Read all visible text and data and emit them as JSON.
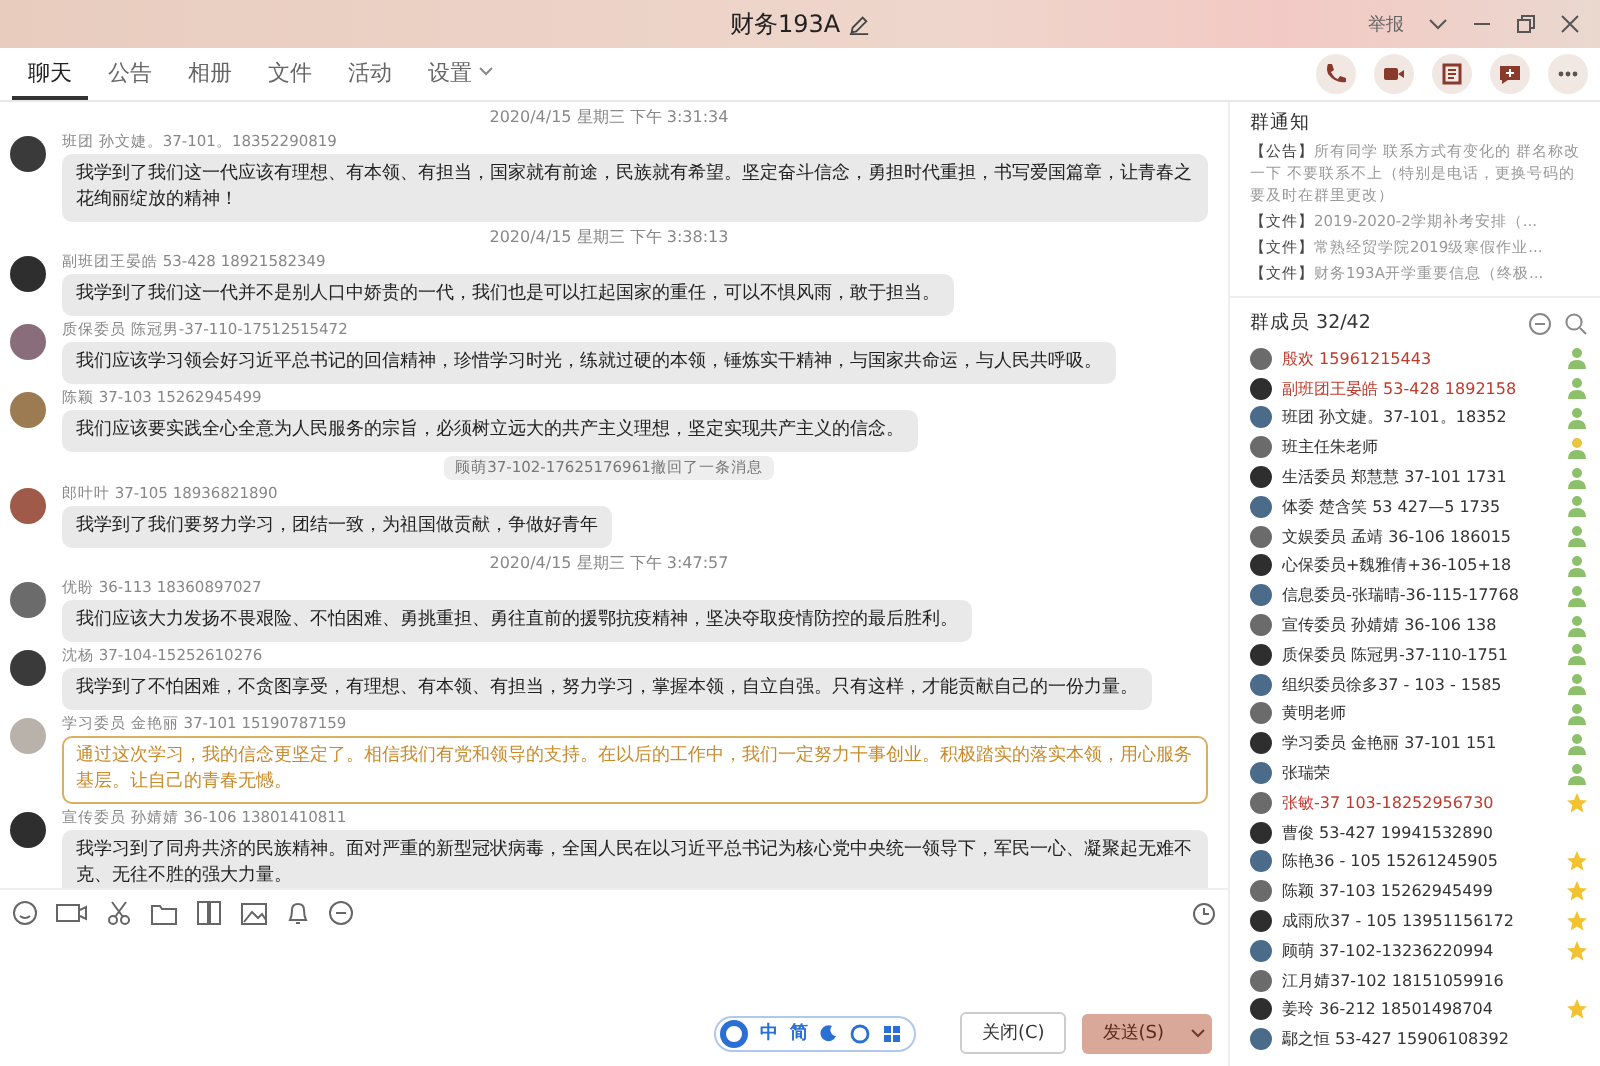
{
  "window": {
    "title": "财务193A",
    "report": "举报"
  },
  "tabs": [
    {
      "label": "聊天",
      "selected": true
    },
    {
      "label": "公告",
      "selected": false
    },
    {
      "label": "相册",
      "selected": false
    },
    {
      "label": "文件",
      "selected": false
    },
    {
      "label": "活动",
      "selected": false
    },
    {
      "label": "设置",
      "selected": false,
      "dropdown": true
    }
  ],
  "feed": [
    {
      "kind": "time",
      "text": "2020/4/15 星期三 下午 3:31:34"
    },
    {
      "kind": "message",
      "sender": "班团 孙文婕。37-101。18352290819",
      "text": "我学到了我们这一代应该有理想、有本领、有担当，国家就有前途，民族就有希望。坚定奋斗信念，勇担时代重担，书写爱国篇章，让青春之花绚丽绽放的精神！",
      "highlighted": false
    },
    {
      "kind": "time",
      "text": "2020/4/15 星期三 下午 3:38:13"
    },
    {
      "kind": "message",
      "sender": "副班团王晏皓 53-428 18921582349",
      "text": "我学到了我们这一代并不是别人口中娇贵的一代，我们也是可以扛起国家的重任，可以不惧风雨，敢于担当。",
      "highlighted": false
    },
    {
      "kind": "message",
      "sender": "质保委员 陈冠男-37-110-17512515472",
      "text": "我们应该学习领会好习近平总书记的回信精神，珍惜学习时光，练就过硬的本领，锤炼实干精神，与国家共命运，与人民共呼吸。",
      "highlighted": false
    },
    {
      "kind": "message",
      "sender": "陈颖 37-103 15262945499",
      "text": "我们应该要实践全心全意为人民服务的宗旨，必须树立远大的共产主义理想，坚定实现共产主义的信念。",
      "highlighted": false
    },
    {
      "kind": "recall",
      "text": "顾萌37-102-17625176961撤回了一条消息"
    },
    {
      "kind": "message",
      "sender": "郎叶叶 37-105 18936821890",
      "text": "我学到了我们要努力学习，团结一致，为祖国做贡献，争做好青年",
      "highlighted": false
    },
    {
      "kind": "time",
      "text": "2020/4/15 星期三 下午 3:47:57"
    },
    {
      "kind": "message",
      "sender": "优盼 36-113 18360897027",
      "text": "我们应该大力发扬不畏艰险、不怕困难、勇挑重担、勇往直前的援鄂抗疫精神，坚决夺取疫情防控的最后胜利。",
      "highlighted": false
    },
    {
      "kind": "message",
      "sender": "沈杨 37-104-15252610276",
      "text": "我学到了不怕困难，不贪图享受，有理想、有本领、有担当，努力学习，掌握本领，自立自强。只有这样，才能贡献自己的一份力量。",
      "highlighted": false
    },
    {
      "kind": "message",
      "sender": "学习委员 金艳丽 37-101 15190787159",
      "text": "通过这次学习，我的信念更坚定了。相信我们有党和领导的支持。在以后的工作中，我们一定努力干事创业。积极踏实的落实本领，用心服务基层。让自己的青春无憾。",
      "highlighted": true
    },
    {
      "kind": "message",
      "sender": "宣传委员 孙婧婧 36-106 13801410811",
      "text": "我学习到了同舟共济的民族精神。面对严重的新型冠状病毒，全国人民在以习近平总书记为核心党中央统一领导下，军民一心、凝聚起无难不克、无往不胜的强大力量。",
      "highlighted": false
    }
  ],
  "input": {
    "ime": [
      "中",
      "简"
    ],
    "close_button": "关闭(C)",
    "send_button": "发送(S)"
  },
  "notice": {
    "title": "群通知",
    "items": [
      {
        "tag": "【公告】",
        "text": "所有同学 联系方式有变化的 群名称改一下 不要联系不上（特别是电话，更换号码的要及时在群里更改）"
      },
      {
        "tag": "【文件】",
        "text": "2019-2020-2学期补考安排（..."
      },
      {
        "tag": "【文件】",
        "text": "常熟经贸学院2019级寒假作业..."
      },
      {
        "tag": "【文件】",
        "text": "财务193A开学重要信息（终极..."
      }
    ]
  },
  "members": {
    "title": "群成员 32/42",
    "items": [
      {
        "name": "殷欢 15961215443",
        "color": "#c0392b",
        "kind": "admin"
      },
      {
        "name": "副班团王晏皓 53-428 1892158",
        "color": "#c0392b",
        "kind": "admin"
      },
      {
        "name": "班团 孙文婕。37-101。18352",
        "color": "#333333",
        "kind": "admin"
      },
      {
        "name": "班主任朱老师",
        "color": "#333333",
        "kind": "owner"
      },
      {
        "name": "生活委员 郑慧慧 37-101 1731",
        "color": "#333333",
        "kind": "admin"
      },
      {
        "name": "体委 楚含笑 53 427—5  1735",
        "color": "#333333",
        "kind": "admin"
      },
      {
        "name": "文娱委员 孟靖 36-106 186015",
        "color": "#333333",
        "kind": "admin"
      },
      {
        "name": "心保委员+魏雅倩+36-105+18",
        "color": "#333333",
        "kind": "admin"
      },
      {
        "name": "信息委员-张瑞晴-36-115-17768",
        "color": "#333333",
        "kind": "admin"
      },
      {
        "name": "宣传委员 孙婧婧 36-106 138",
        "color": "#333333",
        "kind": "admin"
      },
      {
        "name": "质保委员 陈冠男-37-110-1751",
        "color": "#333333",
        "kind": "admin"
      },
      {
        "name": "组织委员徐多37 - 103 - 1585",
        "color": "#333333",
        "kind": "admin"
      },
      {
        "name": "黄明老师",
        "color": "#333333",
        "kind": "admin"
      },
      {
        "name": "学习委员 金艳丽 37-101 151",
        "color": "#333333",
        "kind": "admin"
      },
      {
        "name": "张瑞荣",
        "color": "#333333",
        "kind": "admin"
      },
      {
        "name": "张敏-37 103-18252956730",
        "color": "#c0392b",
        "kind": "star"
      },
      {
        "name": "曹俊 53-427 19941532890",
        "color": "#333333",
        "kind": "plain"
      },
      {
        "name": "陈艳36 - 105  15261245905",
        "color": "#333333",
        "kind": "star"
      },
      {
        "name": "陈颖 37-103 15262945499",
        "color": "#333333",
        "kind": "star"
      },
      {
        "name": "成雨欣37 - 105 13951156172",
        "color": "#333333",
        "kind": "star"
      },
      {
        "name": "顾萌  37-102-13236220994",
        "color": "#333333",
        "kind": "star"
      },
      {
        "name": "江月婧37-102  18151059916",
        "color": "#333333",
        "kind": "plain"
      },
      {
        "name": "姜玲 36-212 18501498704",
        "color": "#333333",
        "kind": "star"
      },
      {
        "name": "鄢之恒 53-427 15906108392",
        "color": "#333333",
        "kind": "plain"
      }
    ]
  }
}
